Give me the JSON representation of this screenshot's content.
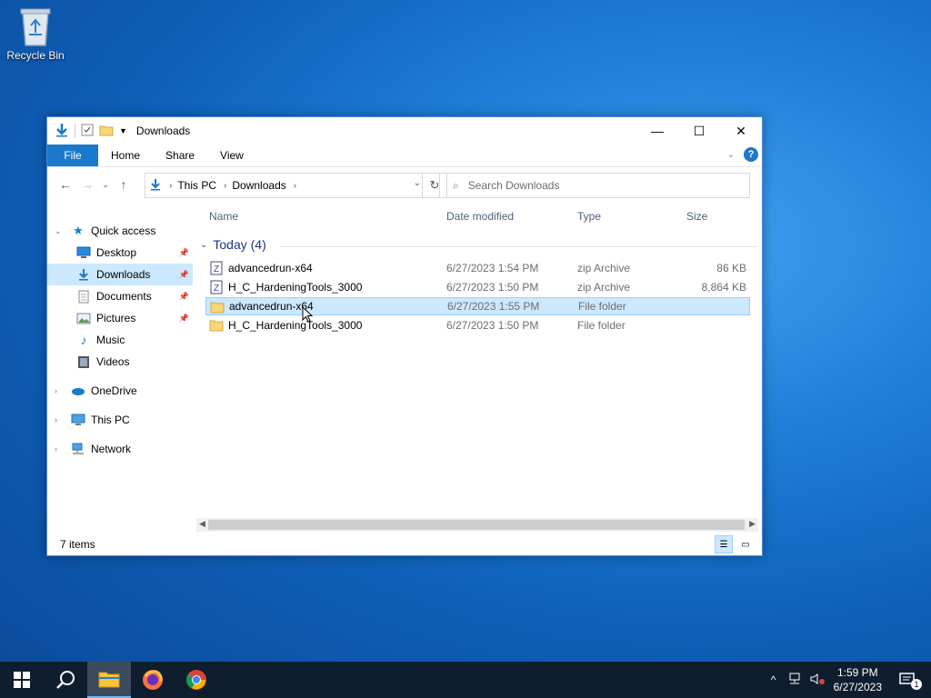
{
  "desktop": {
    "recycle_bin_label": "Recycle Bin"
  },
  "window": {
    "title": "Downloads",
    "controls": {
      "minimize": "—",
      "maximize": "☐",
      "close": "✕"
    },
    "ribbon_tabs": [
      "File",
      "Home",
      "Share",
      "View"
    ],
    "address": {
      "crumbs": [
        "This PC",
        "Downloads"
      ]
    },
    "search": {
      "placeholder": "Search Downloads"
    },
    "nav_pane": {
      "quick_access": "Quick access",
      "quick_items": [
        "Desktop",
        "Downloads",
        "Documents",
        "Pictures",
        "Music",
        "Videos"
      ],
      "onedrive": "OneDrive",
      "this_pc": "This PC",
      "network": "Network"
    },
    "columns": {
      "name": "Name",
      "date": "Date modified",
      "type": "Type",
      "size": "Size"
    },
    "group_header": "Today (4)",
    "files": [
      {
        "name": "advancedrun-x64",
        "date": "6/27/2023 1:54 PM",
        "type": "zip Archive",
        "size": "86 KB",
        "icon": "zip-icon",
        "selected": false
      },
      {
        "name": "H_C_HardeningTools_3000",
        "date": "6/27/2023 1:50 PM",
        "type": "zip Archive",
        "size": "8,864 KB",
        "icon": "zip-icon",
        "selected": false
      },
      {
        "name": "advancedrun-x64",
        "date": "6/27/2023 1:55 PM",
        "type": "File folder",
        "size": "",
        "icon": "folder-icon",
        "selected": true
      },
      {
        "name": "H_C_HardeningTools_3000",
        "date": "6/27/2023 1:50 PM",
        "type": "File folder",
        "size": "",
        "icon": "folder-icon",
        "selected": false
      }
    ],
    "status": "7 items"
  },
  "taskbar": {
    "time": "1:59 PM",
    "date": "6/27/2023",
    "notification_count": "1"
  },
  "colors": {
    "accent": "#1979ca",
    "selection": "#cce8ff",
    "taskbar": "#0f1e2e"
  }
}
